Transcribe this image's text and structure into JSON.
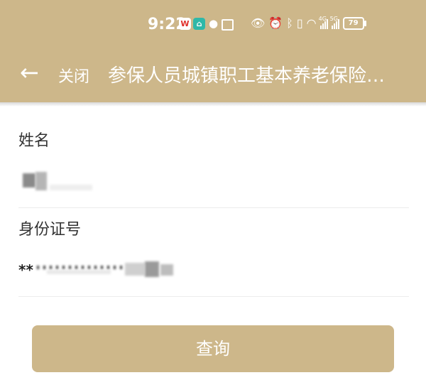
{
  "status_bar": {
    "time": "9:22",
    "network_1": "4G",
    "network_2": "5G",
    "battery": "79"
  },
  "app_bar": {
    "back_icon": "←",
    "close_label": "关闭",
    "title": "参保人员城镇职工基本养老保险…"
  },
  "form": {
    "name_label": "姓名",
    "name_value": "",
    "id_label": "身份证号",
    "id_value_prefix": "**"
  },
  "query_button": {
    "label": "查询"
  },
  "colors": {
    "accent": "#cdb78a",
    "text": "#333333",
    "divider": "#ececec"
  }
}
